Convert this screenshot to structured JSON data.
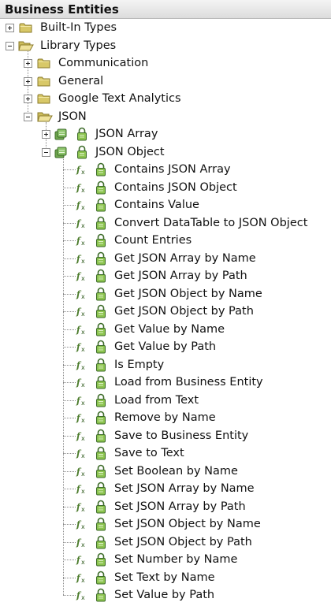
{
  "panel": {
    "title": "Business Entities"
  },
  "tree": {
    "built_in_types": "Built-In Types",
    "library_types": "Library Types",
    "communication": "Communication",
    "general": "General",
    "google_text_analytics": "Google Text Analytics",
    "json": "JSON",
    "json_array": "JSON Array",
    "json_object": "JSON Object",
    "methods": [
      "Contains JSON Array",
      "Contains JSON Object",
      "Contains Value",
      "Convert DataTable to JSON Object",
      "Count Entries",
      "Get JSON Array by Name",
      "Get JSON Array by Path",
      "Get JSON Object by Name",
      "Get JSON Object by Path",
      "Get Value by Name",
      "Get Value by Path",
      "Is Empty",
      "Load from Business Entity",
      "Load from Text",
      "Remove by Name",
      "Save to Business Entity",
      "Save to Text",
      "Set Boolean by Name",
      "Set JSON Array by Name",
      "Set JSON Array by Path",
      "Set JSON Object by Name",
      "Set JSON Object by Path",
      "Set Number by Name",
      "Set Text by Name",
      "Set Value by Path"
    ]
  },
  "icons": {
    "folder": "folder-icon",
    "entity": "business-entity-icon",
    "lock": "lock-icon",
    "method": "function-icon"
  },
  "colors": {
    "folder": "#d8c868",
    "entity": "#6fa74e",
    "lock": "#8cc44f",
    "method": "#4a7a2a"
  }
}
